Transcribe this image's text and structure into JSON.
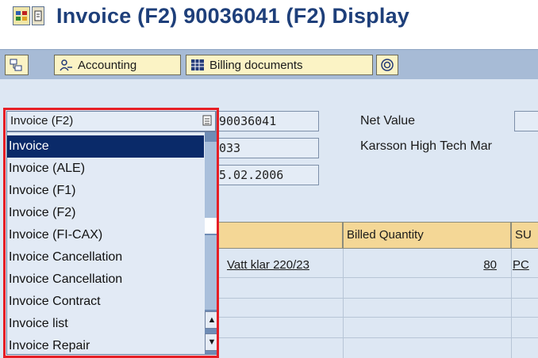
{
  "title": {
    "text": "Invoice (F2) 90036041   (F2) Display"
  },
  "toolbar": {
    "accounting_label": "Accounting",
    "billing_docs_label": "Billing documents"
  },
  "header": {
    "doc_number": "90036041",
    "payer": "033",
    "billing_date": "5.02.2006",
    "net_value_label": "Net Value",
    "payer_name": "Karsson High Tech Mar"
  },
  "dropdown": {
    "selected": "Invoice (F2)",
    "options": [
      "Invoice",
      "Invoice (ALE)",
      "Invoice (F1)",
      "Invoice (F2)",
      "Invoice (FI-CAX)",
      "Invoice Cancellation",
      "Invoice Cancellation",
      "Invoice Contract",
      "Invoice list",
      "Invoice Repair"
    ],
    "highlighted_index": 0
  },
  "grid": {
    "columns": [
      "",
      "Billed Quantity",
      "SU"
    ],
    "row1": {
      "description": "Vatt klar 220/23",
      "quantity": "80",
      "unit": "PC"
    }
  },
  "colors": {
    "title": "#1e3f7a",
    "toolbar": "#a7bbd6",
    "body": "#dde7f3",
    "selected": "#0a2a69",
    "highlight": "#e61e25"
  }
}
